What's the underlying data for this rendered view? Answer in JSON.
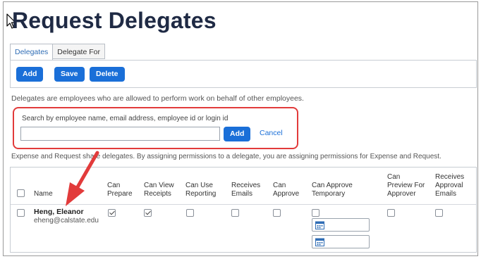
{
  "page": {
    "title": "Request Delegates"
  },
  "tabs": [
    {
      "label": "Delegates",
      "active": true
    },
    {
      "label": "Delegate For",
      "active": false
    }
  ],
  "toolbar": {
    "add_label": "Add",
    "save_label": "Save",
    "delete_label": "Delete"
  },
  "description": "Delegates are employees who are allowed to perform work on behalf of other employees.",
  "search": {
    "label": "Search by employee name, email address, employee id or login id",
    "value": "",
    "add_label": "Add",
    "cancel_label": "Cancel"
  },
  "shared_note": "Expense and Request share delegates. By assigning permissions to a delegate, you are assigning permissions for Expense and Request.",
  "table": {
    "columns": [
      {
        "key": "name",
        "label": "Name"
      },
      {
        "key": "can_prepare",
        "label": "Can\nPrepare"
      },
      {
        "key": "can_view_receipts",
        "label": "Can View\nReceipts"
      },
      {
        "key": "can_use_reporting",
        "label": "Can Use\nReporting"
      },
      {
        "key": "receives_emails",
        "label": "Receives\nEmails"
      },
      {
        "key": "can_approve",
        "label": "Can\nApprove"
      },
      {
        "key": "can_approve_temporary",
        "label": "Can Approve\nTemporary"
      },
      {
        "key": "can_preview_for_approver",
        "label": "Can\nPreview For\nApprover"
      },
      {
        "key": "receives_approval_emails",
        "label": "Receives\nApproval\nEmails"
      }
    ],
    "rows": [
      {
        "name": "Heng, Eleanor",
        "email": "eheng@calstate.edu",
        "can_prepare": true,
        "can_view_receipts": true,
        "can_use_reporting": false,
        "receives_emails": false,
        "can_approve": false,
        "can_approve_temporary": false,
        "can_preview_for_approver": false,
        "receives_approval_emails": false
      }
    ]
  },
  "colors": {
    "primary_button": "#1a6fd8",
    "highlight_border": "#e23b3b",
    "annotation_arrow": "#e23b3b",
    "title_text": "#1f2a44"
  },
  "icons": [
    "mouse-cursor-icon",
    "calendar-icon",
    "red-arrow-annotation"
  ]
}
